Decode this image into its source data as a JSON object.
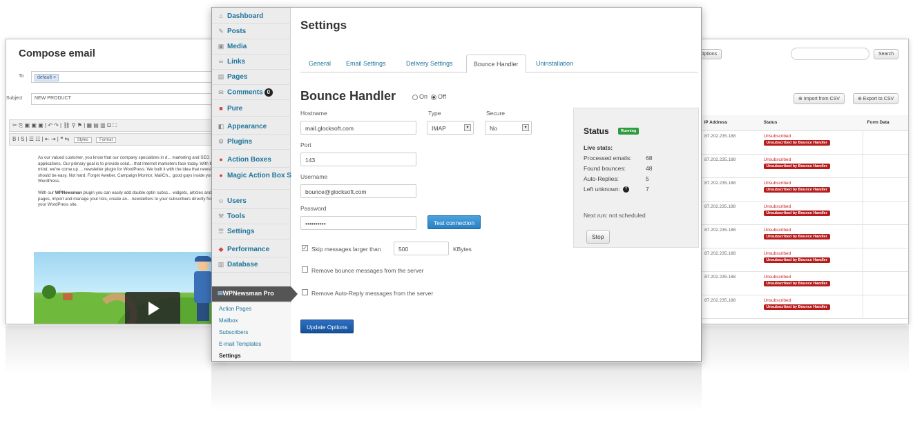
{
  "compose": {
    "title": "Compose email",
    "to_label": "To",
    "to_tag": "default ×",
    "subject_label": "Subject",
    "subject_value": "NEW PRODUCT",
    "toolbar1": "✂ ⎘ ▣ ▣ ▣ | ↶ ↷ | ⛓ ⚲ ⚑ | ▦ ▤ ▥ Ω ⛶",
    "toolbar2": "B I S | ☰ ☷ | ⇤ ⇥ | ❝ ⇆",
    "styles_label": "Styles",
    "format_label": "Format",
    "para1": "As our valued customer, you know that our company specializes in d... marketing and SEO applications. Our primary goal is to provide solut... that Internet marketers face today. With that in mind, we've come up ... newsletter plugin for WordPress. We built it with the idea that newslet... should be easy. Not hard. Forget Aweber, Campaign Monitor, MailCh... good guys inside your WordPress.",
    "para2_bold": "WPNewsman",
    "para2_pre": "With our ",
    "para2_post": " plugin you can easily add double optin subsc... widgets, articles and pages, import and manage your lists, create an... newsletters to your subscribers directly from your WordPress site."
  },
  "subscribers": {
    "options_btn": "Options",
    "search_btn": "Search",
    "import_btn": "⊕ Import from CSV",
    "export_btn": "⊕ Export to CSV",
    "columns": [
      "IP Address",
      "Status",
      "Form Data"
    ],
    "rows": [
      {
        "ip": "87.202.235.188",
        "status": "Unsubscribed",
        "badge": "Unsubscribed by Bounce Handler"
      },
      {
        "ip": "87.202.235.188",
        "status": "Unsubscribed",
        "badge": "Unsubscribed by Bounce Handler"
      },
      {
        "ip": "87.202.235.188",
        "status": "Unsubscribed",
        "badge": "Unsubscribed by Bounce Handler"
      },
      {
        "ip": "87.202.235.188",
        "status": "Unsubscribed",
        "badge": "Unsubscribed by Bounce Handler"
      },
      {
        "ip": "87.202.235.188",
        "status": "Unsubscribed",
        "badge": "Unsubscribed by Bounce Handler"
      },
      {
        "ip": "87.202.235.188",
        "status": "Unsubscribed",
        "badge": "Unsubscribed by Bounce Handler"
      },
      {
        "ip": "87.202.235.188",
        "status": "Unsubscribed",
        "badge": "Unsubscribed by Bounce Handler"
      },
      {
        "ip": "87.202.235.188",
        "status": "Unsubscribed",
        "badge": "Unsubscribed by Bounce Handler"
      }
    ]
  },
  "sidebar": {
    "items": [
      {
        "label": "Dashboard",
        "icon": "dashboard-icon"
      },
      {
        "label": "Posts",
        "icon": "pin-icon"
      },
      {
        "label": "Media",
        "icon": "media-icon"
      },
      {
        "label": "Links",
        "icon": "link-icon"
      },
      {
        "label": "Pages",
        "icon": "page-icon"
      },
      {
        "label": "Comments",
        "icon": "comment-icon",
        "badge": "0"
      },
      {
        "label": "Pure",
        "icon": "pure-icon"
      },
      {
        "label": "Appearance",
        "icon": "appearance-icon"
      },
      {
        "label": "Plugins",
        "icon": "plugin-icon"
      },
      {
        "label": "Action Boxes",
        "icon": "action-icon"
      },
      {
        "label": "Magic Action Box Settings",
        "icon": "magic-icon"
      },
      {
        "label": "Users",
        "icon": "users-icon"
      },
      {
        "label": "Tools",
        "icon": "tools-icon"
      },
      {
        "label": "Settings",
        "icon": "settings-icon"
      },
      {
        "label": "Performance",
        "icon": "performance-icon"
      },
      {
        "label": "Database",
        "icon": "database-icon"
      }
    ],
    "active": "WPNewsman Pro",
    "submenu": [
      "Action Pages",
      "Mailbox",
      "Subscribers",
      "E-mail Templates",
      "Settings"
    ]
  },
  "settings": {
    "title": "Settings",
    "tabs": [
      "General",
      "Email Settings",
      "Delivery Settings",
      "Bounce Handler",
      "Uninstallation"
    ],
    "active_tab": "Bounce Handler",
    "section_title": "Bounce Handler",
    "on_label": "On",
    "off_label": "Off",
    "hostname_label": "Hostname",
    "hostname_value": "mail.glocksoft.com",
    "type_label": "Type",
    "type_value": "IMAP",
    "secure_label": "Secure",
    "secure_value": "No",
    "port_label": "Port",
    "port_value": "143",
    "username_label": "Username",
    "username_value": "bounce@glocksoft.com",
    "password_label": "Password",
    "password_value": "••••••••••",
    "test_btn": "Test connection",
    "skip_label": "Skip messages larger than",
    "skip_value": "500",
    "skip_unit": "KBytes",
    "remove_bounce_label": "Remove bounce messages from the server",
    "remove_auto_label": "Remove Auto-Reply messages from the server",
    "update_btn": "Update Options"
  },
  "status": {
    "title": "Status",
    "badge": "Running",
    "live_label": "Live stats:",
    "stats": [
      {
        "label": "Processed emails:",
        "value": "68"
      },
      {
        "label": "Found bounces:",
        "value": "48"
      },
      {
        "label": "Auto-Replies:",
        "value": "5"
      },
      {
        "label": "Left unknown:",
        "value": "7"
      }
    ],
    "next_run": "Next run: not scheduled",
    "stop_btn": "Stop"
  }
}
